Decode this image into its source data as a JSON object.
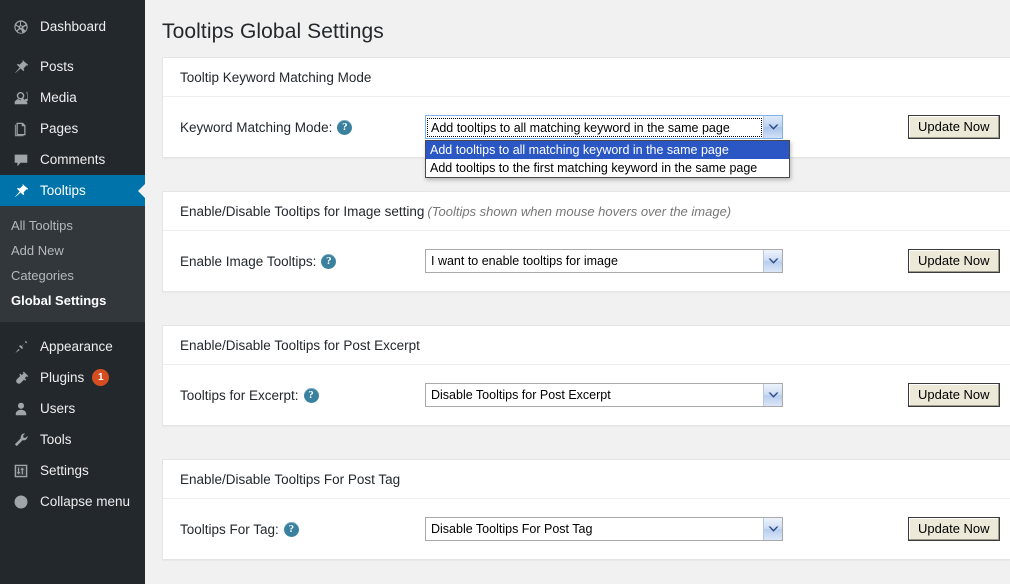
{
  "sidebar": {
    "items": [
      {
        "label": "Dashboard",
        "icon": "dashboard-icon",
        "active": false
      },
      {
        "label": "Posts",
        "icon": "pin-icon",
        "active": false
      },
      {
        "label": "Media",
        "icon": "media-icon",
        "active": false
      },
      {
        "label": "Pages",
        "icon": "pages-icon",
        "active": false
      },
      {
        "label": "Comments",
        "icon": "comments-icon",
        "active": false
      },
      {
        "label": "Tooltips",
        "icon": "pin-icon",
        "active": true
      },
      {
        "label": "Appearance",
        "icon": "appearance-icon",
        "active": false
      },
      {
        "label": "Plugins",
        "icon": "plugins-icon",
        "active": false,
        "badge": "1"
      },
      {
        "label": "Users",
        "icon": "users-icon",
        "active": false
      },
      {
        "label": "Tools",
        "icon": "tools-icon",
        "active": false
      },
      {
        "label": "Settings",
        "icon": "settings-icon",
        "active": false
      },
      {
        "label": "Collapse menu",
        "icon": "collapse-icon",
        "active": false
      }
    ],
    "submenu": [
      {
        "label": "All Tooltips",
        "current": false
      },
      {
        "label": "Add New",
        "current": false
      },
      {
        "label": "Categories",
        "current": false
      },
      {
        "label": "Global Settings",
        "current": true
      }
    ],
    "accent_color": "#0073aa",
    "background_color": "#23282d",
    "submenu_background_color": "#32373c",
    "badge_color": "#d54e21"
  },
  "page": {
    "title": "Tooltips Global Settings"
  },
  "panels": [
    {
      "heading": "Tooltip Keyword Matching Mode",
      "hint": "",
      "row_label": "Keyword Matching Mode:",
      "help_icon": "?",
      "select_value": "Add tooltips to all matching keyword in the same page",
      "select_open": true,
      "options": [
        "Add tooltips to all matching keyword in the same page",
        "Add tooltips to the first matching keyword in the same page"
      ],
      "selected_index": 0,
      "button_label": "Update Now"
    },
    {
      "heading": "Enable/Disable Tooltips for Image setting",
      "hint": "(Tooltips shown when mouse hovers over the image)",
      "row_label": "Enable Image Tooltips:",
      "help_icon": "?",
      "select_value": "I want to enable tooltips for image",
      "select_open": false,
      "options": [],
      "selected_index": 0,
      "button_label": "Update Now"
    },
    {
      "heading": "Enable/Disable Tooltips for Post Excerpt",
      "hint": "",
      "row_label": "Tooltips for Excerpt:",
      "help_icon": "?",
      "select_value": "Disable Tooltips for Post Excerpt",
      "select_open": false,
      "options": [],
      "selected_index": 0,
      "button_label": "Update Now"
    },
    {
      "heading": "Enable/Disable Tooltips For Post Tag",
      "hint": "",
      "row_label": "Tooltips For Tag:",
      "help_icon": "?",
      "select_value": "Disable Tooltips For Post Tag",
      "select_open": false,
      "options": [],
      "selected_index": 0,
      "button_label": "Update Now"
    }
  ]
}
